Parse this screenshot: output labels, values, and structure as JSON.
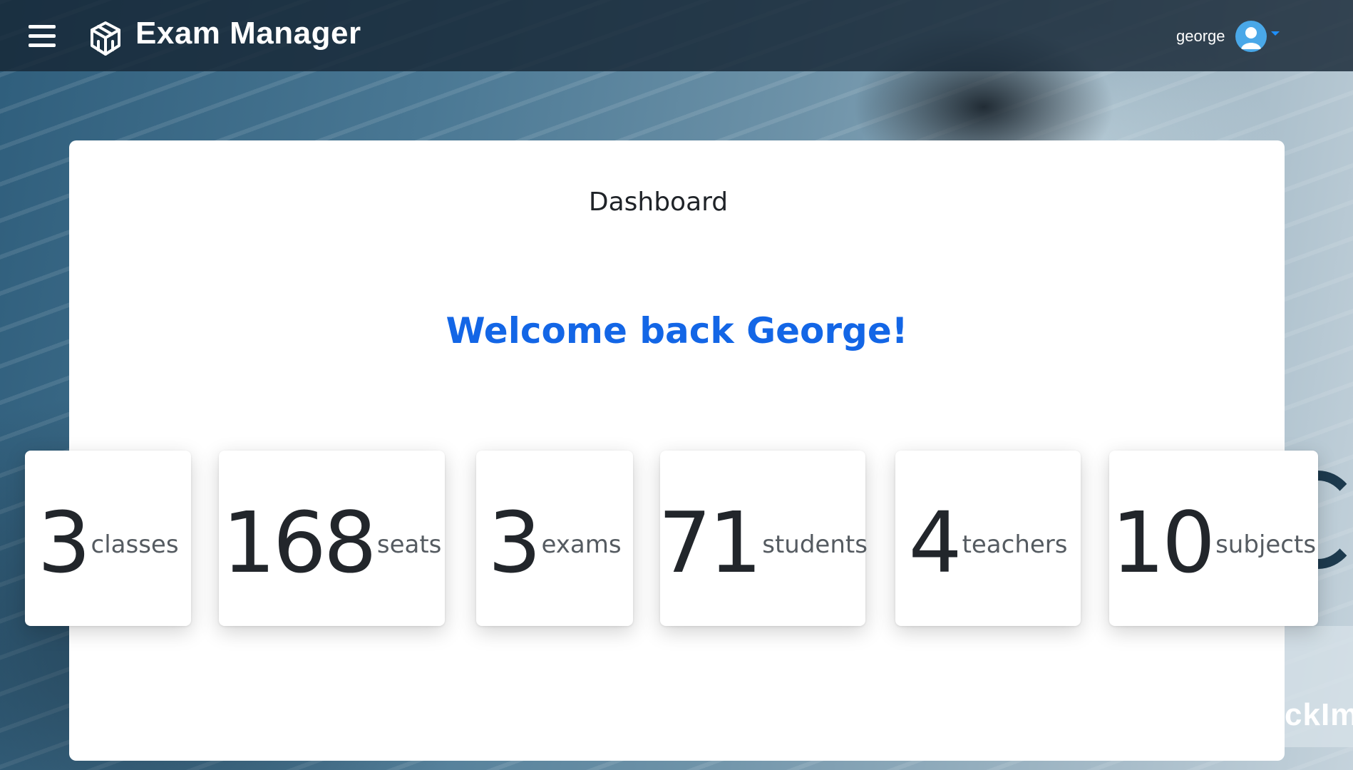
{
  "app": {
    "title": "Exam Manager"
  },
  "header": {
    "menu_icon": "hamburger-menu-icon",
    "logo_icon": "cube-logo-icon",
    "username": "george",
    "avatar_icon": "user-avatar-icon",
    "dropdown_icon": "caret-down-icon"
  },
  "main": {
    "page_title": "Dashboard",
    "welcome": "Welcome back George!",
    "stats": [
      {
        "value": "3",
        "label": "classes"
      },
      {
        "value": "168",
        "label": "seats"
      },
      {
        "value": "3",
        "label": "exams"
      },
      {
        "value": "71",
        "label": "students"
      },
      {
        "value": "4",
        "label": "teachers"
      },
      {
        "value": "10",
        "label": "subjects"
      }
    ]
  },
  "background": {
    "watermark_text": "ckIm"
  },
  "colors": {
    "navbar": "#162634",
    "accent_blue": "#1366e6",
    "card": "#ffffff",
    "text_dark": "#22262b"
  }
}
